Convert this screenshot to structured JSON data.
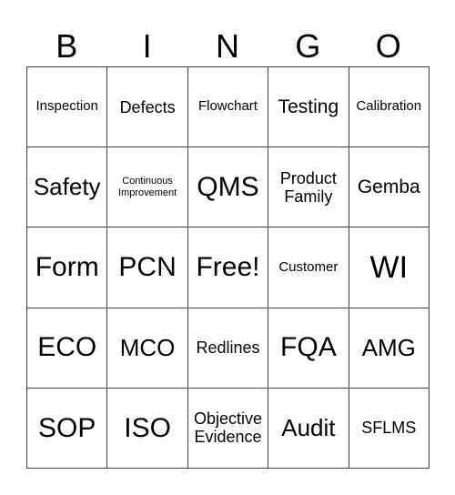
{
  "header": {
    "letters": [
      "B",
      "I",
      "N",
      "G",
      "O"
    ]
  },
  "cells": [
    [
      "Inspection",
      "Defects",
      "Flowchart",
      "Testing",
      "Calibration"
    ],
    [
      "Safety",
      "Continuous Improvement",
      "QMS",
      "Product Family",
      "Gemba"
    ],
    [
      "Form",
      "PCN",
      "Free!",
      "Customer",
      "WI"
    ],
    [
      "ECO",
      "MCO",
      "Redlines",
      "FQA",
      "AMG"
    ],
    [
      "SOP",
      "ISO",
      "Objective Evidence",
      "Audit",
      "SFLMS"
    ]
  ]
}
